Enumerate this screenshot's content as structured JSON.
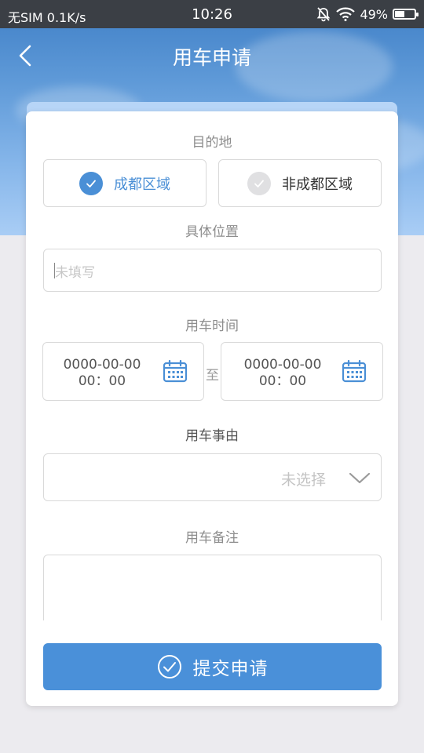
{
  "status_bar": {
    "carrier": "无SIM",
    "speed": "0.1K/s",
    "time": "10:26",
    "battery": "49%",
    "battery_level": 0.49
  },
  "header": {
    "title": "用车申请"
  },
  "form": {
    "destination": {
      "label": "目的地",
      "options": [
        {
          "label": "成都区域",
          "selected": true
        },
        {
          "label": "非成都区域",
          "selected": false
        }
      ]
    },
    "location": {
      "label": "具体位置",
      "placeholder": "未填写"
    },
    "time": {
      "label": "用车时间",
      "start": {
        "date": "0000-00-00",
        "time": "00：00"
      },
      "separator": "至",
      "end": {
        "date": "0000-00-00",
        "time": "00：00"
      }
    },
    "reason": {
      "label": "用车事由",
      "placeholder": "未选择"
    },
    "remarks": {
      "label": "用车备注"
    }
  },
  "submit": {
    "label": "提交申请"
  },
  "colors": {
    "accent": "#4a90d9",
    "sky": "#5f9ad8",
    "status_bar": "#3b3f45"
  },
  "icons": [
    "back-arrow-icon",
    "mute-bell-icon",
    "wifi-icon",
    "battery-icon",
    "check-icon",
    "calendar-icon",
    "chevron-down-icon",
    "check-circle-icon"
  ]
}
